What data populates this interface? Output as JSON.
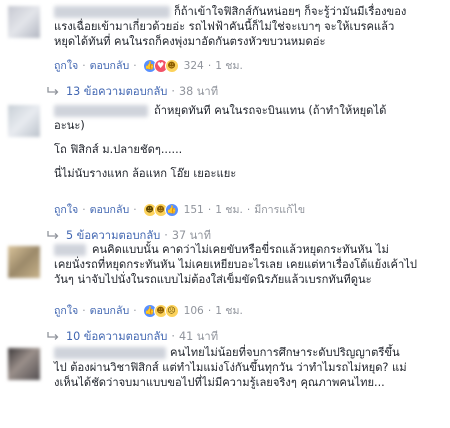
{
  "comments": [
    {
      "lines": [
        "ก็ถ้าเข้าใจฟิสิกส์กันหน่อยๆ ก็จะรู้ว่ามันมีเรื่องของ",
        "แรงเฉื่อยเข้ามาเกี่ยวด้วยอ่ะ รถไฟฟ้าคันนี้ก็ไม่ใช่จะเบาๆ จะให้เบรคแล้ว",
        "หยุดได้ทันที่ คนในรถก็คงพุ่งมาอัดกันตรงหัวขบวนหมดอ่ะ"
      ],
      "like_label": "ถูกใจ",
      "reply_label": "ตอบกลับ",
      "reaction_count": "324",
      "time": "1 ชม.",
      "edited_label": "",
      "replies_label": "13 ข้อความตอบกลับ",
      "replies_time": "38 นาที"
    },
    {
      "lines": [
        "ถ้าหยุดทันที คนในรถจะบินแทน (ถ้าทำให้หยุดได้",
        "อะนะ)",
        "",
        "โถ ฟิสิกส์ ม.ปลายชัดๆ......",
        "",
        "นี่ไม่นับรางแหก ล้อแหก โอ๊ย เยอะแยะ"
      ],
      "like_label": "ถูกใจ",
      "reply_label": "ตอบกลับ",
      "reaction_count": "151",
      "time": "1 ชม.",
      "edited_label": "มีการแก้ไข",
      "replies_label": "5 ข้อความตอบกลับ",
      "replies_time": "37 นาที"
    },
    {
      "lines": [
        "คนคิดแบบนั้น คาดว่าไม่เคยขับหรือขี่รถแล้วหยุดกระทันหัน ไม่",
        "เคยนั่งรถที่หยุดกระทันหัน ไม่เคยเหยียบอะไรเลย เคยแต่หาเรื่องโต้แย้งเค้าไป",
        "วันๆ น่าจับไปนั่งในรถแบบไม่ต้องใส่เข็มขัดนิรภัยแล้วเบรกทันทีดูนะ"
      ],
      "like_label": "ถูกใจ",
      "reply_label": "ตอบกลับ",
      "reaction_count": "106",
      "time": "1 ชม.",
      "edited_label": "",
      "replies_label": "10 ข้อความตอบกลับ",
      "replies_time": "41 นาที"
    },
    {
      "lines": [
        "คนไทยไม่น้อยที่จบการศึกษาระดับปริญญาตรีขึ้น",
        "ไป ต้องผ่านวิชาฟิสิกส์ แต่ทำไมแม่งโง่กันขึ้นทุกวัน ว่าทำไมรถไม่หยุด? แม่",
        "งเห็นได้ชัดว่าจบมาแบบขอไปที่ไม่มีความรู้เลยจริงๆ คุณภาพคนไทย..."
      ]
    }
  ],
  "icons": {
    "like": "like-reaction-icon",
    "love": "love-reaction-icon",
    "haha": "haha-reaction-icon",
    "sad": "sad-reaction-icon",
    "reply_arrow": "reply-arrow-icon"
  },
  "colors": {
    "link": "#4267b2",
    "meta": "#90949c",
    "text": "#1d2129"
  }
}
